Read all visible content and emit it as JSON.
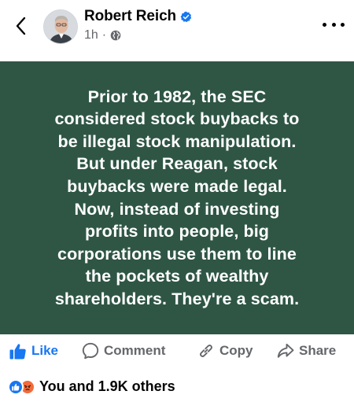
{
  "header": {
    "author_name": "Robert Reich",
    "time": "1h",
    "separator": "·"
  },
  "icons": {
    "back": "chevron-left-icon",
    "verified": "verified-badge-icon",
    "audience": "globe-icon",
    "more": "more-horizontal-icon",
    "like": "thumbs-up-icon",
    "comment": "comment-bubble-icon",
    "copy": "link-icon",
    "share": "share-arrow-icon"
  },
  "post": {
    "text": "Prior to 1982, the SEC\nconsidered stock buybacks to\nbe illegal stock manipulation.\nBut under Reagan, stock\nbuybacks were made legal.\nNow, instead of investing\nprofits into people, big\ncorporations use them to line\nthe pockets of wealthy\nshareholders. They're a scam."
  },
  "actions": {
    "like": "Like",
    "comment": "Comment",
    "copy": "Copy",
    "share": "Share"
  },
  "reactions": {
    "summary": "You and 1.9K others"
  },
  "colors": {
    "post_background": "#2f5645",
    "accent_blue": "#1877f2",
    "muted": "#65676b",
    "angry": "#f26b3a"
  }
}
